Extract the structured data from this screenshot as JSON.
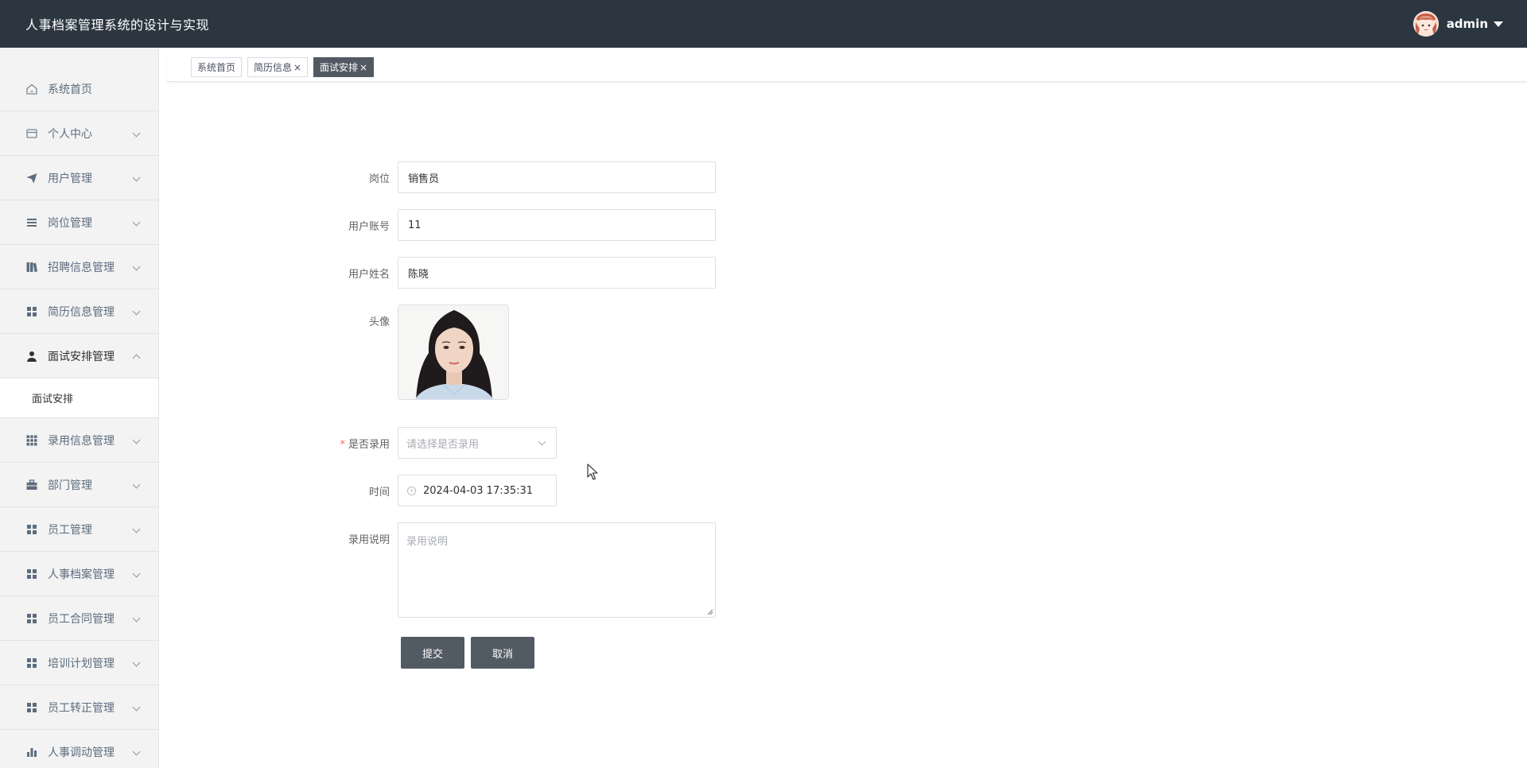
{
  "header": {
    "title": "人事档案管理系统的设计与实现",
    "username": "admin"
  },
  "sidebar": {
    "items": [
      {
        "label": "系统首页",
        "icon": "home-icon"
      },
      {
        "label": "个人中心",
        "icon": "wallet-icon"
      },
      {
        "label": "用户管理",
        "icon": "send-icon"
      },
      {
        "label": "岗位管理",
        "icon": "list-icon"
      },
      {
        "label": "招聘信息管理",
        "icon": "books-icon"
      },
      {
        "label": "简历信息管理",
        "icon": "grid-icon"
      },
      {
        "label": "面试安排管理",
        "icon": "person-icon"
      },
      {
        "label": "录用信息管理",
        "icon": "apps-icon"
      },
      {
        "label": "部门管理",
        "icon": "briefcase-icon"
      },
      {
        "label": "员工管理",
        "icon": "grid-icon"
      },
      {
        "label": "人事档案管理",
        "icon": "grid-icon"
      },
      {
        "label": "员工合同管理",
        "icon": "grid-icon"
      },
      {
        "label": "培训计划管理",
        "icon": "grid-icon"
      },
      {
        "label": "员工转正管理",
        "icon": "grid-icon"
      },
      {
        "label": "人事调动管理",
        "icon": "bar-chart-icon"
      }
    ],
    "submenu": {
      "label": "面试安排"
    }
  },
  "tabs": [
    {
      "label": "系统首页"
    },
    {
      "label": "简历信息"
    },
    {
      "label": "面试安排"
    }
  ],
  "tab_close": "×",
  "form": {
    "position_label": "岗位",
    "position_value": "销售员",
    "account_label": "用户账号",
    "account_value": "11",
    "name_label": "用户姓名",
    "name_value": "陈晓",
    "avatar_label": "头像",
    "hired_label": "是否录用",
    "hired_required": "*",
    "hired_placeholder": "请选择是否录用",
    "time_label": "时间",
    "time_value": "2024-04-03 17:35:31",
    "note_label": "录用说明",
    "note_placeholder": "录用说明",
    "submit_label": "提交",
    "cancel_label": "取消"
  },
  "colors": {
    "header_bg": "#2b3641",
    "button_bg": "#525b64",
    "active_tab_bg": "#515a63",
    "required": "#f56c6c"
  }
}
